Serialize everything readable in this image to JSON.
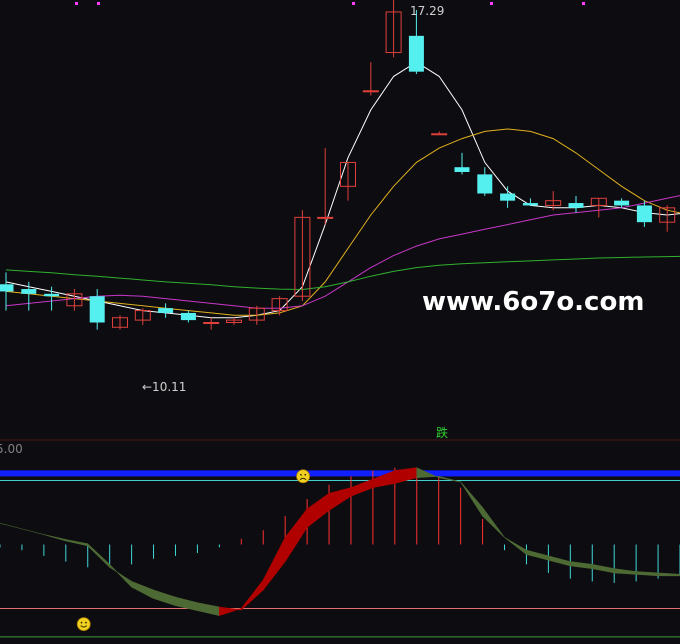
{
  "colors": {
    "background": "#0d0c10",
    "up_candle": "#e0403c",
    "down_candle": "#54f0f0",
    "ma_fast": "#ffffff",
    "ma_mid": "#e0b020",
    "ma_slow": "#c838c8",
    "ma_long": "#30b030",
    "band_rise": "#b00000",
    "band_fall": "#4e6a34",
    "hist_pos": "#ff3030",
    "hist_neg": "#40d8d8",
    "level_blue": "#1020ff",
    "level_cyan": "#40d0d0",
    "level_pink": "#e07070",
    "level_green": "#40a040",
    "marker_top": "#ff40ff"
  },
  "chart_data": [
    {
      "type": "candlestick",
      "title": "",
      "ylim": [
        8.5,
        17.5
      ],
      "annotations": {
        "high_label": "17.29",
        "low_label": "←10.11",
        "signal_label": "跌",
        "watermark": "www.6o7o.com"
      },
      "candles": [
        {
          "o": 11.55,
          "h": 11.8,
          "l": 11.0,
          "c": 11.4
        },
        {
          "o": 11.45,
          "h": 11.6,
          "l": 11.0,
          "c": 11.35
        },
        {
          "o": 11.35,
          "h": 11.5,
          "l": 11.0,
          "c": 11.3
        },
        {
          "o": 11.1,
          "h": 11.45,
          "l": 11.0,
          "c": 11.35
        },
        {
          "o": 11.3,
          "h": 11.45,
          "l": 10.6,
          "c": 10.75
        },
        {
          "o": 10.65,
          "h": 10.9,
          "l": 10.6,
          "c": 10.85
        },
        {
          "o": 10.8,
          "h": 11.05,
          "l": 10.7,
          "c": 11.0
        },
        {
          "o": 11.05,
          "h": 11.15,
          "l": 10.85,
          "c": 10.95
        },
        {
          "o": 10.95,
          "h": 11.0,
          "l": 10.75,
          "c": 10.8
        },
        {
          "o": 10.75,
          "h": 10.85,
          "l": 10.6,
          "c": 10.75
        },
        {
          "o": 10.75,
          "h": 10.85,
          "l": 10.7,
          "c": 10.8
        },
        {
          "o": 10.8,
          "h": 11.1,
          "l": 10.7,
          "c": 11.05
        },
        {
          "o": 11.0,
          "h": 11.3,
          "l": 10.9,
          "c": 11.25
        },
        {
          "o": 11.3,
          "h": 13.1,
          "l": 11.2,
          "c": 12.95
        },
        {
          "o": 12.95,
          "h": 14.4,
          "l": 12.8,
          "c": 12.95
        },
        {
          "o": 13.6,
          "h": 14.1,
          "l": 13.3,
          "c": 14.1
        },
        {
          "o": 15.6,
          "h": 16.2,
          "l": 15.5,
          "c": 15.6
        },
        {
          "o": 16.4,
          "h": 17.5,
          "l": 16.3,
          "c": 17.25
        },
        {
          "o": 16.75,
          "h": 17.29,
          "l": 15.95,
          "c": 16.0
        },
        {
          "o": 14.7,
          "h": 14.75,
          "l": 14.7,
          "c": 14.7
        },
        {
          "o": 14.0,
          "h": 14.3,
          "l": 13.85,
          "c": 13.9
        },
        {
          "o": 13.85,
          "h": 14.0,
          "l": 13.4,
          "c": 13.45
        },
        {
          "o": 13.45,
          "h": 13.6,
          "l": 13.15,
          "c": 13.3
        },
        {
          "o": 13.25,
          "h": 13.35,
          "l": 13.2,
          "c": 13.2
        },
        {
          "o": 13.2,
          "h": 13.5,
          "l": 13.1,
          "c": 13.3
        },
        {
          "o": 13.25,
          "h": 13.4,
          "l": 13.05,
          "c": 13.15
        },
        {
          "o": 13.2,
          "h": 13.35,
          "l": 12.95,
          "c": 13.35
        },
        {
          "o": 13.3,
          "h": 13.35,
          "l": 13.15,
          "c": 13.2
        },
        {
          "o": 13.2,
          "h": 13.3,
          "l": 12.75,
          "c": 12.85
        },
        {
          "o": 12.85,
          "h": 13.2,
          "l": 12.65,
          "c": 13.15
        },
        {
          "o": 13.2,
          "h": 13.45,
          "l": 12.95,
          "c": 13.2
        }
      ],
      "series": [
        {
          "name": "",
          "values": [
            11.6,
            11.5,
            11.4,
            11.3,
            11.2,
            11.1,
            11.0,
            10.95,
            10.9,
            10.85,
            10.85,
            10.9,
            11.0,
            11.5,
            12.8,
            14.2,
            15.2,
            15.9,
            16.2,
            15.9,
            15.2,
            14.1,
            13.5,
            13.2,
            13.15,
            13.15,
            13.2,
            13.15,
            13.05,
            13.0,
            13.05
          ]
        },
        {
          "name": "",
          "values": [
            11.4,
            11.35,
            11.3,
            11.25,
            11.2,
            11.15,
            11.1,
            11.05,
            11.0,
            10.95,
            10.9,
            10.9,
            10.95,
            11.1,
            11.6,
            12.3,
            13.0,
            13.6,
            14.1,
            14.4,
            14.6,
            14.75,
            14.8,
            14.75,
            14.6,
            14.3,
            13.95,
            13.6,
            13.3,
            13.1,
            13.0
          ]
        },
        {
          "name": "",
          "values": [
            11.1,
            11.15,
            11.2,
            11.25,
            11.3,
            11.32,
            11.3,
            11.25,
            11.2,
            11.15,
            11.1,
            11.05,
            11.05,
            11.1,
            11.3,
            11.6,
            11.9,
            12.15,
            12.35,
            12.5,
            12.6,
            12.7,
            12.8,
            12.9,
            13.0,
            13.05,
            13.1,
            13.15,
            13.25,
            13.35,
            13.45
          ]
        },
        {
          "name": "",
          "values": [
            11.85,
            11.82,
            11.79,
            11.75,
            11.72,
            11.68,
            11.64,
            11.6,
            11.57,
            11.54,
            11.5,
            11.47,
            11.45,
            11.44,
            11.5,
            11.6,
            11.72,
            11.82,
            11.9,
            11.95,
            11.98,
            12.0,
            12.02,
            12.04,
            12.06,
            12.08,
            12.1,
            12.11,
            12.12,
            12.13,
            12.14
          ]
        }
      ]
    },
    {
      "type": "area",
      "title": "",
      "ylim": [
        -2,
        12
      ],
      "tick_labels": [
        "5.00"
      ],
      "levels": [
        10,
        9.5,
        0.5,
        -1.5
      ],
      "line_a": [
        6.5,
        6.1,
        5.7,
        5.35,
        5.05,
        3.6,
        2.0,
        1.2,
        0.7,
        0.35,
        0.0,
        0.5,
        2.5,
        5.5,
        7.5,
        8.6,
        9.0,
        9.6,
        10.2,
        10.4,
        9.7,
        9.4,
        7.0,
        5.5,
        4.6,
        4.2,
        3.8,
        3.6,
        3.3,
        3.1,
        3.0,
        2.9
      ],
      "line_b": [
        6.5,
        6.1,
        5.7,
        5.25,
        4.9,
        3.4,
        2.4,
        1.8,
        1.3,
        0.9,
        0.6,
        0.4,
        1.8,
        3.8,
        6.2,
        7.4,
        8.4,
        9.0,
        9.3,
        9.7,
        9.8,
        9.4,
        7.6,
        5.5,
        4.3,
        3.9,
        3.5,
        3.3,
        3.0,
        2.9,
        2.8,
        2.8
      ],
      "histogram": [
        -0.1,
        -0.2,
        -0.4,
        -0.6,
        -0.8,
        -0.8,
        -0.7,
        -0.5,
        -0.4,
        -0.3,
        -0.1,
        0.2,
        0.5,
        1.0,
        1.6,
        2.1,
        2.4,
        2.6,
        2.7,
        2.6,
        2.4,
        2.0,
        0.9,
        -0.2,
        -0.7,
        -1.0,
        -1.2,
        -1.3,
        -1.35,
        -1.3,
        -1.2,
        -1.1
      ],
      "hist_zero": 5.0,
      "face_markers": [
        {
          "index": 4,
          "y": -0.6,
          "mood": "happy"
        },
        {
          "index": 14,
          "y": 9.8,
          "mood": "sad"
        }
      ]
    }
  ]
}
